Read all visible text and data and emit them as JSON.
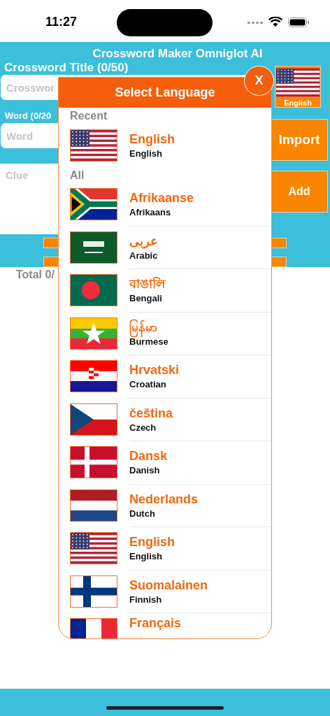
{
  "status_bar": {
    "time": "11:27"
  },
  "app": {
    "title": "Crossword Maker Omniglot AI",
    "title_label": "Crossword Title (0/50)",
    "title_placeholder": "Crosswor",
    "word_label": "Word (0/20",
    "word_placeholder": "Word",
    "clue_placeholder": "Clue",
    "language_button": {
      "kind": "us",
      "label": "English"
    },
    "import_button": "Import",
    "add_button": "Add",
    "total": "Total 0/"
  },
  "dialog": {
    "title": "Select Language",
    "close": "X",
    "sections": [
      {
        "title": "Recent",
        "items": [
          {
            "kind": "us",
            "name": "English",
            "subtitle": "English"
          }
        ]
      },
      {
        "title": "All",
        "items": [
          {
            "kind": "za",
            "name": "Afrikaanse",
            "subtitle": "Afrikaans"
          },
          {
            "kind": "sa",
            "name": "عربى",
            "subtitle": "Arabic"
          },
          {
            "kind": "bd",
            "name": "বাঙালি",
            "subtitle": "Bengali"
          },
          {
            "kind": "mm",
            "name": "မြန်မာ",
            "subtitle": "Burmese"
          },
          {
            "kind": "hr",
            "name": "Hrvatski",
            "subtitle": "Croatian"
          },
          {
            "kind": "cz",
            "name": "čeština",
            "subtitle": "Czech"
          },
          {
            "kind": "dk",
            "name": "Dansk",
            "subtitle": "Danish"
          },
          {
            "kind": "nl",
            "name": "Nederlands",
            "subtitle": "Dutch"
          },
          {
            "kind": "us",
            "name": "English",
            "subtitle": "English"
          },
          {
            "kind": "fi",
            "name": "Suomalainen",
            "subtitle": "Finnish"
          },
          {
            "kind": "fr",
            "name": "Français"
          }
        ]
      }
    ]
  }
}
